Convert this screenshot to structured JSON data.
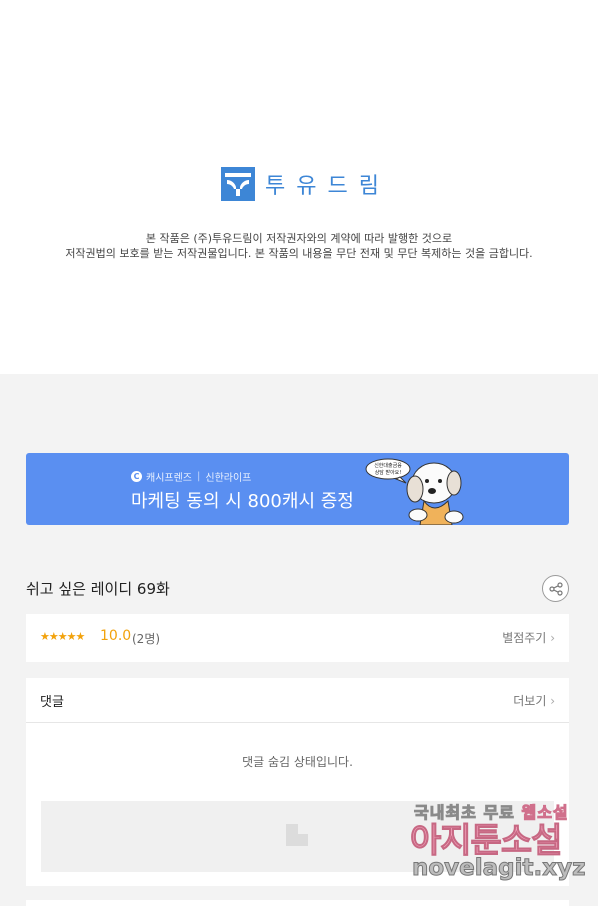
{
  "header": {
    "logo_text": "투유드림",
    "notice_line1": "본 작품은 (주)투유드림이 저작권자와의 계약에 따라 발행한 것으로",
    "notice_line2": "저작권법의 보호를 받는 저작권물입니다. 본 작품의 내용을 무단 전재 및 무단 복제하는 것을 금합니다."
  },
  "banner": {
    "brand_cash": "캐시프렌즈",
    "brand_partner": "신한라이프",
    "title": "마케팅 동의 시 800캐시 증정",
    "bubble_text": "신한대출금융 상담 받아요!",
    "accent_color": "#5a8ff1"
  },
  "episode": {
    "title": "쉬고 싶은 레이디 69화",
    "share_icon": "share-icon"
  },
  "rating": {
    "stars": "★★★★★",
    "score": "10.0",
    "count": "(2명)",
    "rate_link": "별점주기"
  },
  "comments": {
    "title": "댓글",
    "more_link": "더보기",
    "hidden_message": "댓글 숨김 상태입니다."
  },
  "watermark": {
    "line1_a": "국내최초 무료 ",
    "line1_b": "웹소설",
    "line2": "아지툰소설",
    "line3": "novelagit.xyz"
  }
}
